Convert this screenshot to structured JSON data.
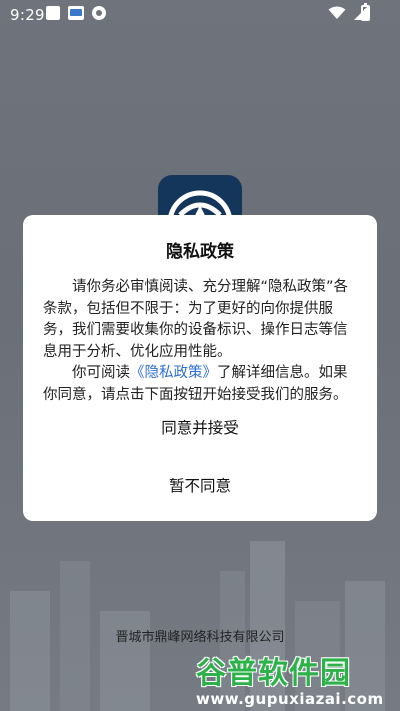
{
  "status_bar": {
    "time": "9:29",
    "icons_left": [
      "square-notification-icon",
      "app-badge-icon",
      "circle-app-icon"
    ],
    "icons_right": [
      "wifi-icon",
      "signal-icon",
      "battery-icon"
    ]
  },
  "dialog": {
    "title": "隐私政策",
    "paragraph1": "请你务必审慎阅读、充分理解“隐私政策”各条款，包括但不限于：为了更好的向你提供服务，我们需要收集你的设备标识、操作日志等信息用于分析、优化应用性能。",
    "paragraph2_before": "你可阅读",
    "policy_link": "《隐私政策》",
    "paragraph2_after": "了解详细信息。如果你同意，请点击下面按钮开始接受我们的服务。",
    "accept_label": "同意并接受",
    "decline_label": "暂不同意",
    "link_color": "#2f6fd1"
  },
  "splash": {
    "company": "晋城市鼎峰网络科技有限公司"
  },
  "watermark": {
    "title": "谷普软件园",
    "url": "www.gupuxiazai.com"
  }
}
